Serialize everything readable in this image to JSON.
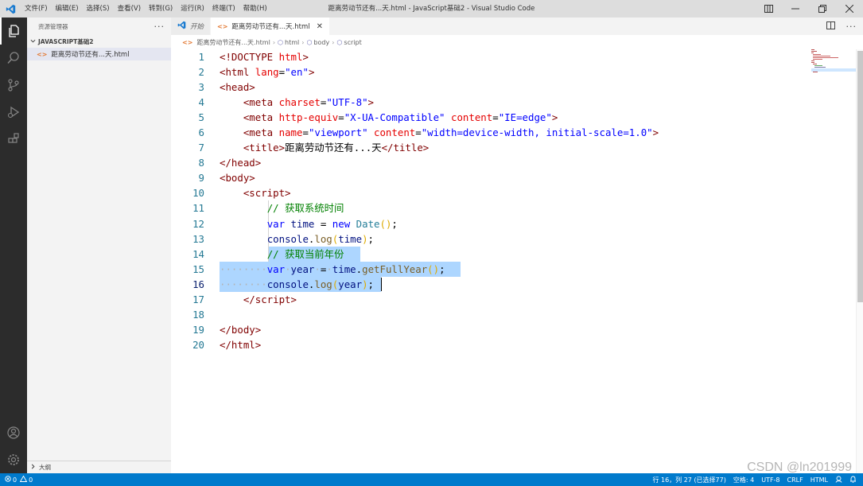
{
  "titlebar": {
    "menu": [
      "文件(F)",
      "编辑(E)",
      "选择(S)",
      "查看(V)",
      "转到(G)",
      "运行(R)",
      "终端(T)",
      "帮助(H)"
    ],
    "title": "距离劳动节还有...天.html - JavaScript基础2 - Visual Studio Code"
  },
  "sidebar": {
    "header": "资源管理器",
    "folder": "JAVASCRIPT基础2",
    "file": "距离劳动节还有...天.html",
    "outline": "大纲"
  },
  "tabs": [
    {
      "label": "开始"
    },
    {
      "label": "距离劳动节还有...天.html"
    }
  ],
  "breadcrumb": {
    "file": "距离劳动节还有...天.html",
    "items": [
      "html",
      "body",
      "script"
    ]
  },
  "editor": {
    "line_numbers": [
      "1",
      "2",
      "3",
      "4",
      "5",
      "6",
      "7",
      "8",
      "9",
      "10",
      "11",
      "12",
      "13",
      "14",
      "15",
      "16",
      "17",
      "18",
      "19",
      "20"
    ],
    "current_line": 16
  },
  "statusbar": {
    "errors": "0",
    "warnings": "0",
    "position": "行 16，列 27 (已选择77)",
    "indent": "空格: 4",
    "encoding": "UTF-8",
    "eol": "CRLF",
    "language": "HTML"
  },
  "watermark": "CSDN @ln201999",
  "colors": {
    "accent": "#007acc",
    "selection": "#add6ff",
    "activity_bar": "#2c2c2c"
  }
}
